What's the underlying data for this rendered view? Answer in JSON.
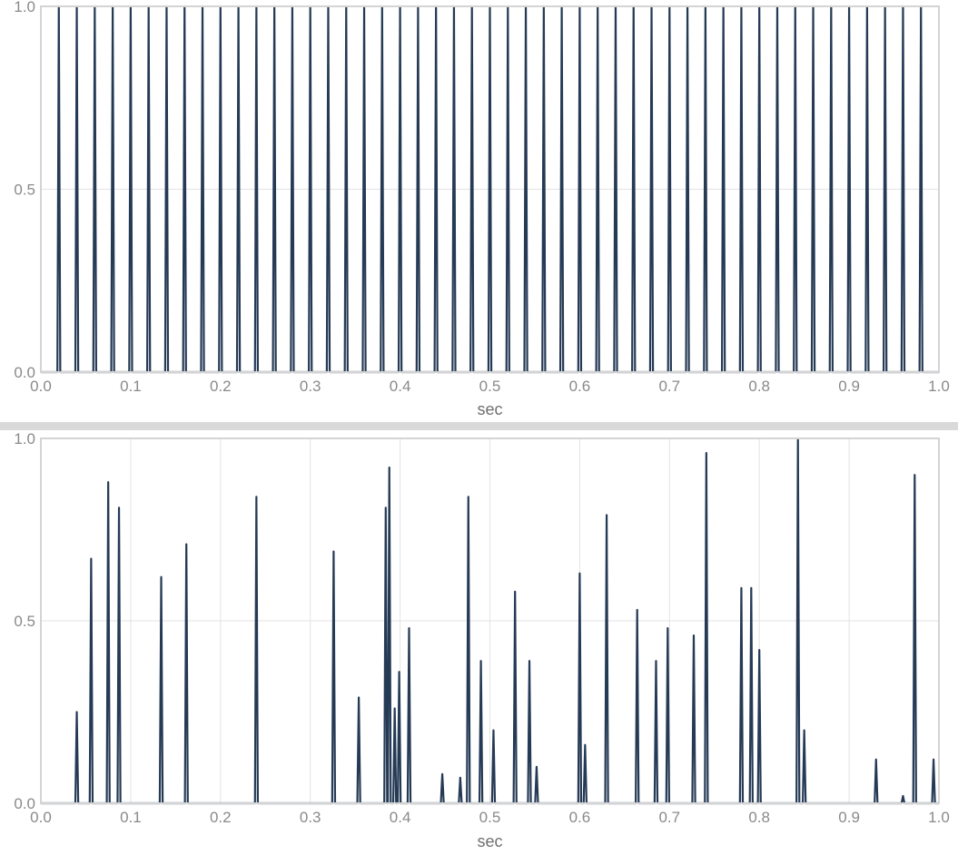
{
  "chart_data": [
    {
      "type": "line",
      "xlabel": "sec",
      "ylabel": "",
      "xlim": [
        0.0,
        1.0
      ],
      "ylim": [
        0.0,
        1.0
      ],
      "x_ticks": [
        "0.0",
        "0.1",
        "0.2",
        "0.3",
        "0.4",
        "0.5",
        "0.6",
        "0.7",
        "0.8",
        "0.9",
        "1.0"
      ],
      "y_ticks": [
        "0.0",
        "0.5",
        "1.0"
      ],
      "grid": true,
      "legend": "none",
      "line_color": "#253a55",
      "series": [
        {
          "pattern": "periodic impulse train",
          "start": 0.02,
          "period": 0.02,
          "count": 49,
          "amplitude": 1.0
        }
      ]
    },
    {
      "type": "line",
      "xlabel": "sec",
      "ylabel": "",
      "xlim": [
        0.0,
        1.0
      ],
      "ylim": [
        0.0,
        1.0
      ],
      "x_ticks": [
        "0.0",
        "0.1",
        "0.2",
        "0.3",
        "0.4",
        "0.5",
        "0.6",
        "0.7",
        "0.8",
        "0.9",
        "1.0"
      ],
      "y_ticks": [
        "0.0",
        "0.5",
        "1.0"
      ],
      "grid": true,
      "legend": "none",
      "line_color": "#253a55",
      "series": [
        {
          "pattern": "random impulses",
          "impulses": [
            [
              0.04,
              0.25
            ],
            [
              0.056,
              0.67
            ],
            [
              0.075,
              0.88
            ],
            [
              0.087,
              0.81
            ],
            [
              0.134,
              0.62
            ],
            [
              0.162,
              0.71
            ],
            [
              0.24,
              0.84
            ],
            [
              0.326,
              0.69
            ],
            [
              0.354,
              0.29
            ],
            [
              0.384,
              0.81
            ],
            [
              0.388,
              0.92
            ],
            [
              0.394,
              0.26
            ],
            [
              0.399,
              0.36
            ],
            [
              0.41,
              0.48
            ],
            [
              0.447,
              0.08
            ],
            [
              0.467,
              0.07
            ],
            [
              0.476,
              0.84
            ],
            [
              0.49,
              0.39
            ],
            [
              0.504,
              0.2
            ],
            [
              0.528,
              0.58
            ],
            [
              0.544,
              0.39
            ],
            [
              0.552,
              0.1
            ],
            [
              0.6,
              0.63
            ],
            [
              0.606,
              0.16
            ],
            [
              0.63,
              0.79
            ],
            [
              0.664,
              0.53
            ],
            [
              0.685,
              0.39
            ],
            [
              0.698,
              0.48
            ],
            [
              0.727,
              0.46
            ],
            [
              0.741,
              0.96
            ],
            [
              0.78,
              0.59
            ],
            [
              0.791,
              0.59
            ],
            [
              0.8,
              0.42
            ],
            [
              0.843,
              1.0
            ],
            [
              0.85,
              0.2
            ],
            [
              0.93,
              0.12
            ],
            [
              0.96,
              0.02
            ],
            [
              0.973,
              0.9
            ],
            [
              0.994,
              0.12
            ]
          ]
        }
      ]
    }
  ]
}
